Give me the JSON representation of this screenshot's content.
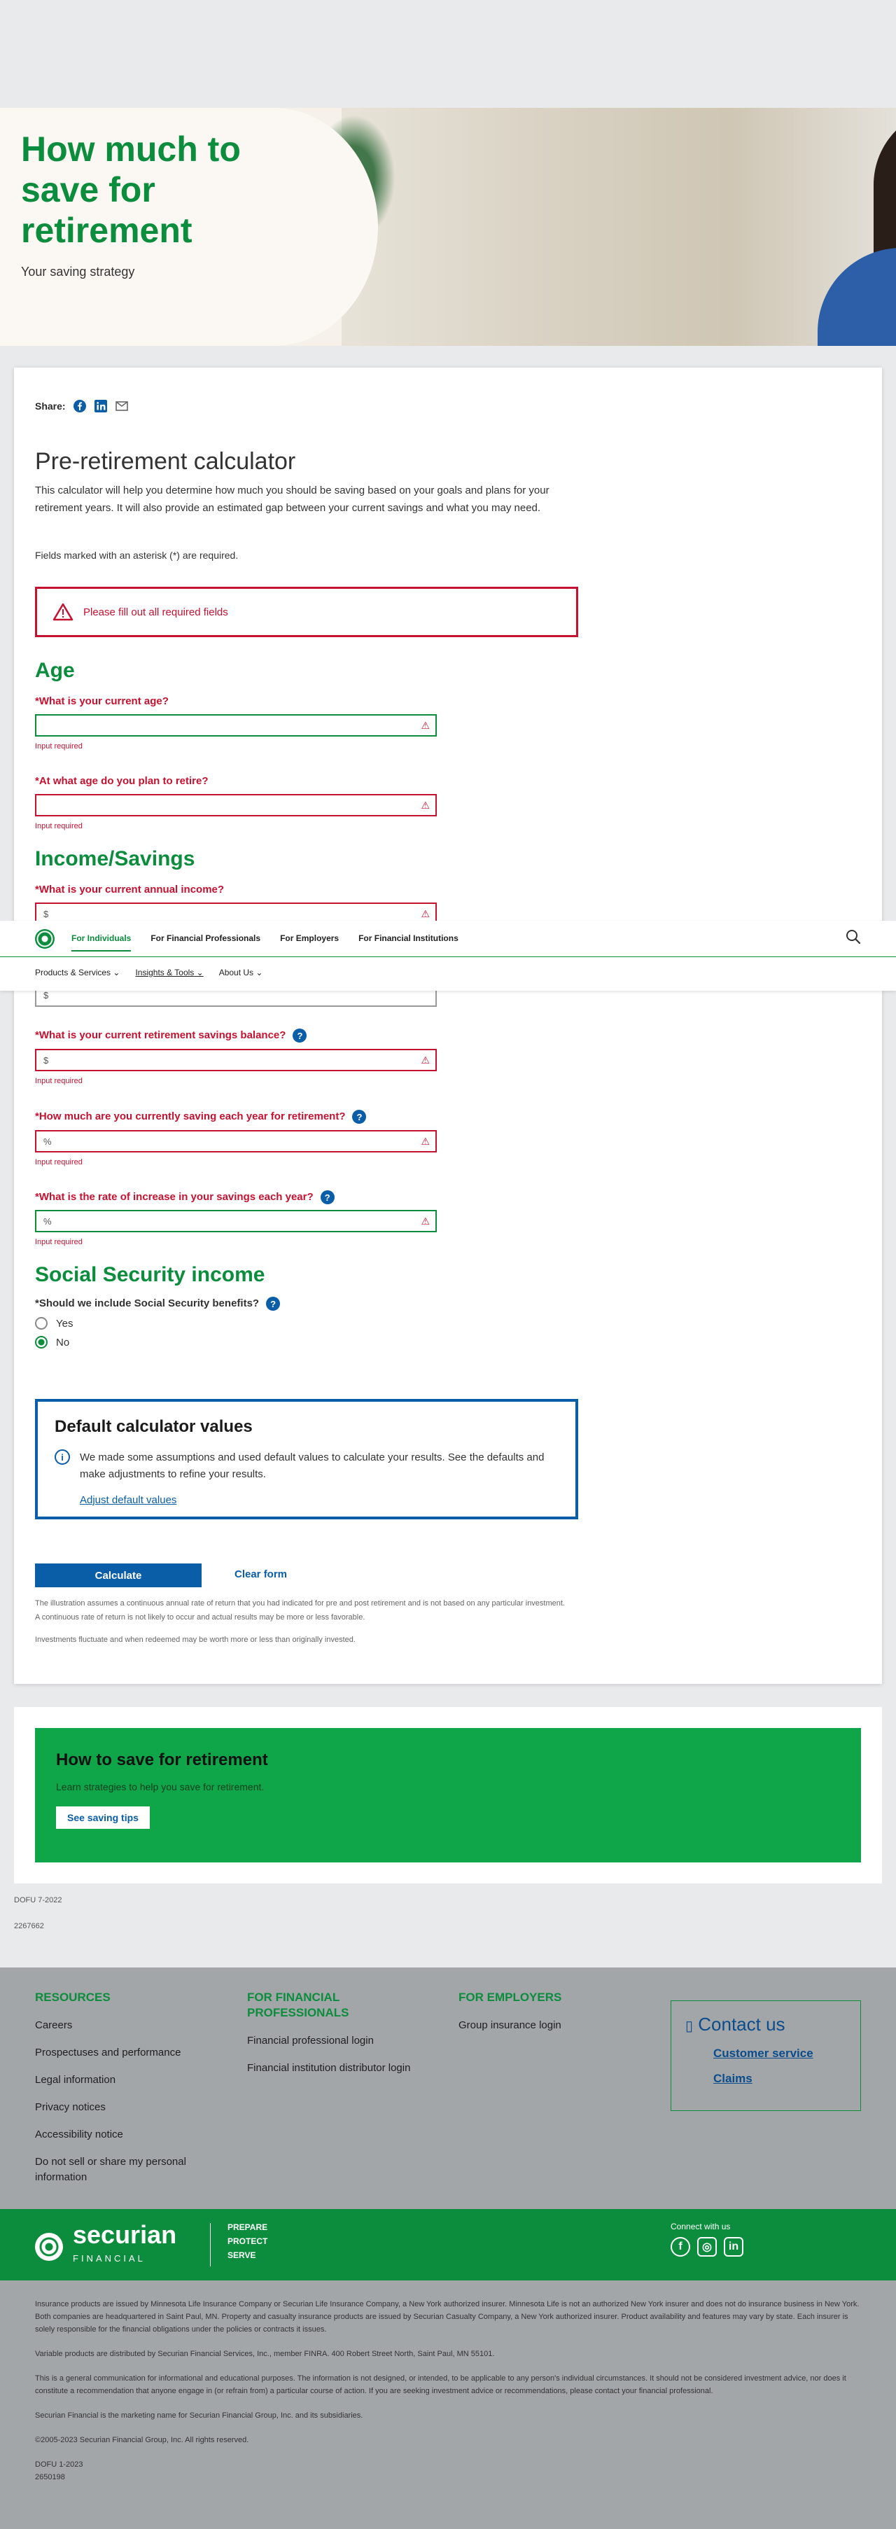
{
  "hero": {
    "title": "How much to save for retirement",
    "subtitle": "Your saving strategy"
  },
  "share": {
    "label": "Share:"
  },
  "calculator": {
    "title": "Pre-retirement calculator",
    "intro": "This calculator will help you determine how much you should be saving based on your goals and plans for your retirement years. It will also provide an estimated gap between your current savings and what you may need.",
    "required_note": "Fields marked with an asterisk (*) are required.",
    "alert": "Please fill out all required fields",
    "sections": {
      "age": "Age",
      "income": "Income/Savings",
      "ss": "Social Security income"
    },
    "fields": {
      "current_age": {
        "label": "*What is your current age?",
        "error": "Input required"
      },
      "retire_age": {
        "label": "*At what age do you plan to retire?",
        "error": "Input required"
      },
      "annual_income": {
        "label": "*What is your current annual income?",
        "prefix": "$"
      },
      "partial_field": {
        "prefix": "$"
      },
      "savings_balance": {
        "label": "*What is your current retirement savings balance?",
        "prefix": "$",
        "error": "Input required"
      },
      "saving_per_year": {
        "label": "*How much are you currently saving each year for retirement?",
        "prefix": "%",
        "error": "Input required"
      },
      "increase_rate": {
        "label": "*What is the rate of increase in your savings each year?",
        "prefix": "%",
        "error": "Input required"
      },
      "ss_benefits": {
        "label": "*Should we include Social Security benefits?",
        "options": [
          "Yes",
          "No"
        ],
        "selected": "No"
      }
    },
    "defaults": {
      "title": "Default calculator values",
      "text": "We made some assumptions and used default values to calculate your results. See the defaults and make adjustments to refine your results.",
      "link": "Adjust default values"
    },
    "calculate": "Calculate",
    "clear": "Clear form",
    "disclaimer1": "The illustration assumes a continuous annual rate of return that you had indicated for pre and post retirement and is not based on any particular investment. A continuous rate of return is not likely to occur and actual results may be more or less favorable.",
    "disclaimer2": "Investments fluctuate and when redeemed may be worth more or less than originally invested."
  },
  "nav": {
    "tabs": [
      "For Individuals",
      "For Financial Professionals",
      "For Employers",
      "For Financial Institutions"
    ],
    "sub": [
      "Products & Services",
      "Insights & Tools",
      "About Us"
    ]
  },
  "promo": {
    "title": "How to save for retirement",
    "text": "Learn strategies to help you save for retirement.",
    "button": "See saving tips"
  },
  "codes": {
    "c1": "DOFU 7-2022",
    "c2": "2267662"
  },
  "footer": {
    "resources": {
      "title": "RESOURCES",
      "links": [
        "Careers",
        "Prospectuses and performance",
        "Legal information",
        "Privacy notices",
        "Accessibility notice",
        "Do not sell or share my personal information"
      ]
    },
    "fin_pros": {
      "title": "FOR FINANCIAL PROFESSIONALS",
      "links": [
        "Financial professional login",
        "Financial institution distributor login"
      ]
    },
    "employers": {
      "title": "FOR EMPLOYERS",
      "links": [
        "Group insurance login"
      ]
    },
    "contact": {
      "title": "Contact us",
      "links": [
        "Customer service",
        "Claims"
      ]
    },
    "brand": {
      "name": "securian",
      "sub": "FINANCIAL",
      "tag1": "PREPARE",
      "tag2": "PROTECT",
      "tag3": "SERVE"
    },
    "connect": "Connect with us",
    "legal": [
      "Insurance products are issued by Minnesota Life Insurance Company or Securian Life Insurance Company, a New York authorized insurer. Minnesota Life is not an authorized New York insurer and does not do insurance business in New York. Both companies are headquartered in Saint Paul, MN. Property and casualty insurance products are issued by Securian Casualty Company, a New York authorized insurer. Product availability and features may vary by state. Each insurer is solely responsible for the financial obligations under the policies or contracts it issues.",
      "Variable products are distributed by Securian Financial Services, Inc., member FINRA. 400 Robert Street North, Saint Paul, MN 55101.",
      "This is a general communication for informational and educational purposes. The information is not designed, or intended, to be applicable to any person's individual circumstances. It should not be considered investment advice, nor does it constitute a recommendation that anyone engage in (or refrain from) a particular course of action. If you are seeking investment advice or recommendations, please contact your financial professional.",
      "Securian Financial is the marketing name for Securian Financial Group, Inc. and its subsidiaries.",
      "©2005-2023 Securian Financial Group, Inc. All rights reserved.",
      "DOFU 1-2023",
      "2650198"
    ]
  }
}
